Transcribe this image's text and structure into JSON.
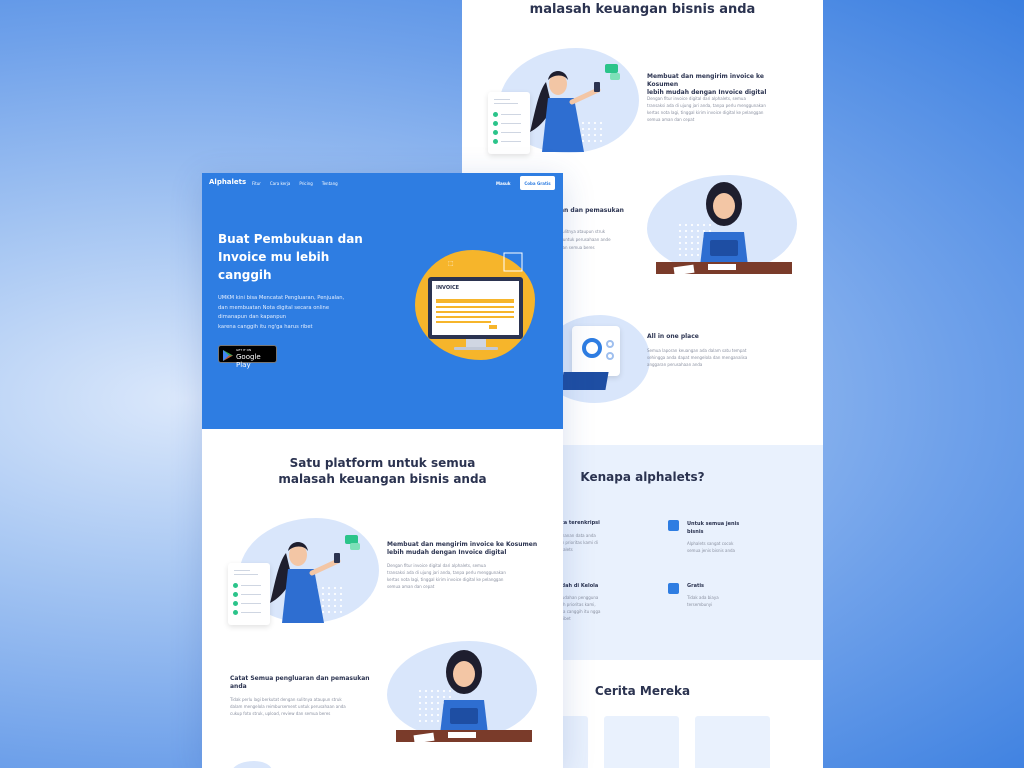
{
  "brand": {
    "name": "Alphalets",
    "accent": "#2e7de2"
  },
  "nav": {
    "items": [
      "Fitur",
      "Cara kerja",
      "Pricing",
      "Tentang"
    ],
    "login": "Masuk",
    "signup": "Coba Gratis"
  },
  "hero": {
    "title_1": "Buat Pembukuan dan",
    "title_2": "Invoice mu lebih",
    "title_3": "canggih",
    "desc_1": "UMKM kini bisa Mencatat Pengluaran, Penjualan,",
    "desc_2": "dan membuatan Nota digital secara online",
    "desc_3": "dimanapun dan kapanpun",
    "desc_4": "karena canggih itu ng'ga harus ribet",
    "store_small": "GET IT ON",
    "store_big": "Google Play",
    "invoice_label": "INVOICE"
  },
  "platform": {
    "title_1": "Satu platform untuk semua",
    "title_2": "malasah keuangan bisnis anda"
  },
  "features": [
    {
      "title_1": "Membuat dan mengirim invoice ke Kosumen",
      "title_2": "lebih mudah dengan Invoice digital",
      "desc_1": "Dengan fitur invoice digital dari alphalets, semua",
      "desc_2": "transaksi ada di ujung jari anda, tanpa perlu menggunakan",
      "desc_3": "kertas nota lagi, tinggal kirim invoice digital ke pelanggan",
      "desc_4": "semua aman dan cepat"
    },
    {
      "title_1": "Catat Semua pengluaran dan pemasukan",
      "title_2": "anda",
      "desc_1": "Tidak perlu lagi berkutat dengan sulitnya ataupun struk",
      "desc_2": "dalam mengelola reimbursement untuk perusahaan anda",
      "desc_3": "cukup foto struk, upload, review dan semua beres"
    },
    {
      "title_1": "All in one place",
      "desc_1": "Semua laporan keuangan ada dalam satu tempat",
      "desc_2": "sehingga anda dapat mengelola dan menganalisa",
      "desc_3": "anggaran perusahaan anda"
    }
  ],
  "right_partial": {
    "pemasukan_fragment": "an dan pemasukan",
    "p1": "sulitnya ataupun struk",
    "p2": "t untuk perusahaan ande",
    "p3": "dan semua beres"
  },
  "why": {
    "title": "Kenapa alphalets?",
    "items": [
      {
        "title": "ata terenkripsi",
        "d1": "amanan data anda",
        "d2": "lah prioritas kami di",
        "d3": "phalets"
      },
      {
        "title_1": "Untuk semua jenis",
        "title_2": "bisnis",
        "d1": "Alphalets sangat cocok",
        "d2": "semua jenis bisnis anda"
      },
      {
        "title": "udah di Kelola",
        "d1": "mudahan pengguna",
        "d2": "dah prioritas kami,",
        "d3": "ena canggih itu ngga",
        "d4": "s ribet"
      },
      {
        "title": "Gratis",
        "d1": "Tidak ada biaya",
        "d2": "tersembunyi"
      }
    ]
  },
  "stories": {
    "title": "Cerita Mereka"
  },
  "colors": {
    "background_outer": "#3b7fe0",
    "hero": "#2e7de2",
    "text_dark": "#2b3350",
    "soft_blue": "#e9f1fd",
    "invoice_yellow": "#f6b52b",
    "green": "#2bc48a"
  }
}
